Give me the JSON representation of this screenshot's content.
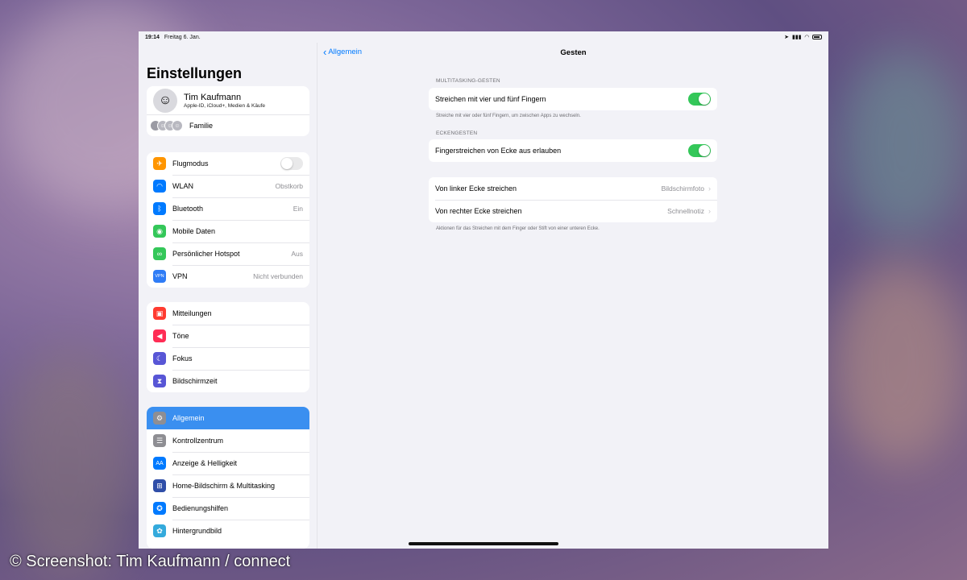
{
  "status_bar": {
    "time": "19:14",
    "date": "Freitag 6. Jan."
  },
  "sidebar": {
    "title": "Einstellungen",
    "profile": {
      "name": "Tim Kaufmann",
      "subtitle": "Apple-ID, iCloud+, Medien & Käufe",
      "family_label": "Familie"
    },
    "groups": [
      [
        {
          "label": "Flugmodus",
          "icon": "airplane-icon",
          "color": "#ff9500",
          "toggle": false
        },
        {
          "label": "WLAN",
          "icon": "wifi-icon",
          "color": "#007aff",
          "value": "Obstkorb"
        },
        {
          "label": "Bluetooth",
          "icon": "bluetooth-icon",
          "color": "#007aff",
          "value": "Ein"
        },
        {
          "label": "Mobile Daten",
          "icon": "antenna-icon",
          "color": "#34c759"
        },
        {
          "label": "Persönlicher Hotspot",
          "icon": "hotspot-icon",
          "color": "#34c759",
          "value": "Aus"
        },
        {
          "label": "VPN",
          "icon": "vpn-icon",
          "color": "#2f7cf6",
          "value": "Nicht verbunden",
          "icon_text": "VPN"
        }
      ],
      [
        {
          "label": "Mitteilungen",
          "icon": "bell-icon",
          "color": "#ff3b30"
        },
        {
          "label": "Töne",
          "icon": "speaker-icon",
          "color": "#ff2d55"
        },
        {
          "label": "Fokus",
          "icon": "moon-icon",
          "color": "#5856d6"
        },
        {
          "label": "Bildschirmzeit",
          "icon": "hourglass-icon",
          "color": "#5856d6"
        }
      ],
      [
        {
          "label": "Allgemein",
          "icon": "gear-icon",
          "color": "#8e8e93",
          "selected": true
        },
        {
          "label": "Kontrollzentrum",
          "icon": "switches-icon",
          "color": "#8e8e93"
        },
        {
          "label": "Anzeige & Helligkeit",
          "icon": "text-size-icon",
          "color": "#007aff",
          "icon_text": "AA"
        },
        {
          "label": "Home-Bildschirm & Multitasking",
          "icon": "grid-icon",
          "color": "#2f4ea8"
        },
        {
          "label": "Bedienungshilfen",
          "icon": "accessibility-icon",
          "color": "#007aff"
        },
        {
          "label": "Hintergrundbild",
          "icon": "flower-icon",
          "color": "#34aadc"
        }
      ]
    ]
  },
  "detail": {
    "back_label": "Allgemein",
    "title": "Gesten",
    "sections": {
      "multitasking": {
        "header": "MULTITASKING-GESTEN",
        "row_label": "Streichen mit vier und fünf Fingern",
        "toggle": true,
        "footer": "Streiche mit vier oder fünf Fingern, um zwischen Apps zu wechseln."
      },
      "corner": {
        "header": "ECKENGESTEN",
        "row_label": "Fingerstreichen von Ecke aus erlauben",
        "toggle": true
      },
      "corner_actions": {
        "rows": [
          {
            "label": "Von linker Ecke streichen",
            "value": "Bildschirmfoto"
          },
          {
            "label": "Von rechter Ecke streichen",
            "value": "Schnellnotiz"
          }
        ],
        "footer": "Aktionen für das Streichen mit dem Finger oder Stift von einer unteren Ecke."
      }
    }
  },
  "watermark": "© Screenshot: Tim Kaufmann / connect"
}
